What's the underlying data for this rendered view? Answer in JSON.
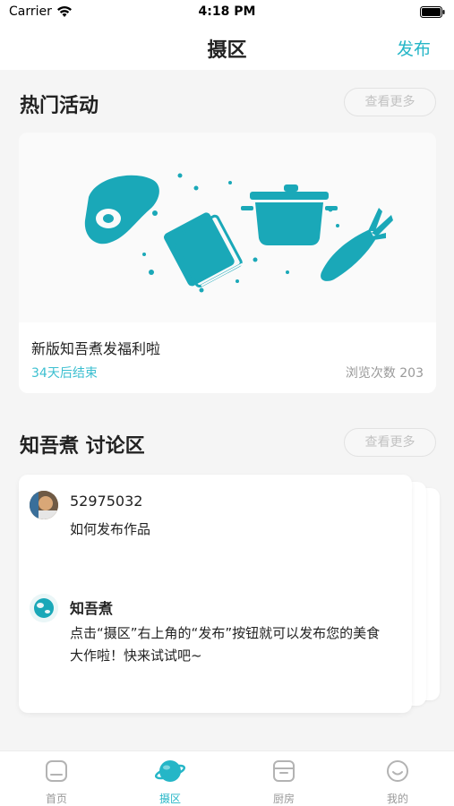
{
  "status_bar": {
    "carrier": "Carrier",
    "time": "4:18 PM"
  },
  "header": {
    "title": "摄区",
    "publish_label": "发布"
  },
  "activities": {
    "title": "热门活动",
    "more_label": "查看更多",
    "card": {
      "title": "新版知吾煮发福利啦",
      "deadline": "34天后结束",
      "views": "浏览次数 203"
    }
  },
  "discussion": {
    "title": "知吾煮 讨论区",
    "more_label": "查看更多",
    "posts": [
      {
        "user": "52975032",
        "text": "如何发布作品"
      },
      {
        "user": "知吾煮",
        "text": "点击“摄区”右上角的“发布”按钮就可以发布您的美食大作啦！快来试试吧~"
      }
    ]
  },
  "tabs": [
    {
      "label": "首页",
      "icon": "home-icon"
    },
    {
      "label": "摄区",
      "icon": "planet-icon"
    },
    {
      "label": "厨房",
      "icon": "kitchen-icon"
    },
    {
      "label": "我的",
      "icon": "smile-icon"
    }
  ],
  "colors": {
    "accent": "#25b6c7",
    "illustration": "#1aa8b8",
    "muted": "#999999"
  }
}
